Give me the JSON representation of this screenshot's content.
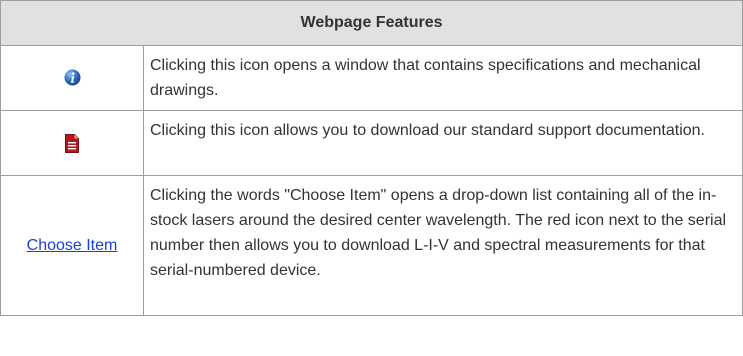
{
  "table": {
    "title": "Webpage Features",
    "rows": [
      {
        "icon": "info-icon",
        "description": "Clicking this icon opens a window that contains specifications and mechanical drawings."
      },
      {
        "icon": "document-icon",
        "description": "Clicking this icon allows you to download our standard support documentation."
      },
      {
        "link_label": "Choose Item",
        "description": "Clicking the words \"Choose Item\" opens a drop-down list containing all of the in-stock lasers around the desired center wavelength. The red icon next to the serial number then allows you to download L-I-V and spectral measurements for that serial-numbered device."
      }
    ]
  },
  "colors": {
    "header_bg": "#e1e1e1",
    "border": "#9e9e9e",
    "text": "#333333",
    "link": "#1a3fd6",
    "info_icon": "#2f6fc3",
    "document_icon": "#b01a1e"
  }
}
